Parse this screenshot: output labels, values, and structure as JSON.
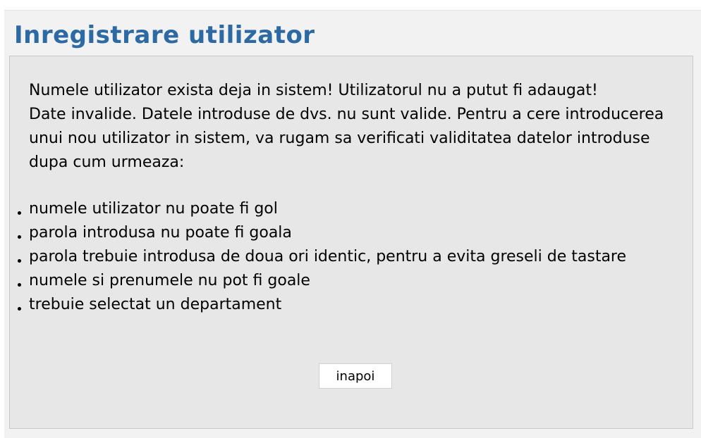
{
  "page": {
    "title": "Inregistrare utilizator"
  },
  "message": {
    "error": "Numele utilizator exista deja in sistem! Utilizatorul nu a putut fi adaugat!",
    "invalid_intro": "Date invalide. Datele introduse de dvs. nu sunt valide. Pentru a cere introducerea unui nou utilizator in sistem, va rugam sa verificati validitatea datelor introduse dupa cum urmeaza:"
  },
  "requirements": [
    "numele utilizator nu poate fi gol",
    "parola introdusa nu poate fi goala",
    "parola trebuie introdusa de doua ori identic, pentru a evita greseli de tastare",
    "numele si prenumele nu pot fi goale",
    "trebuie selectat un departament"
  ],
  "actions": {
    "back_label": "inapoi"
  },
  "colors": {
    "title": "#2d6aa4",
    "panel_background": "#e7e7e7",
    "outer_background": "#f2f2f2"
  }
}
